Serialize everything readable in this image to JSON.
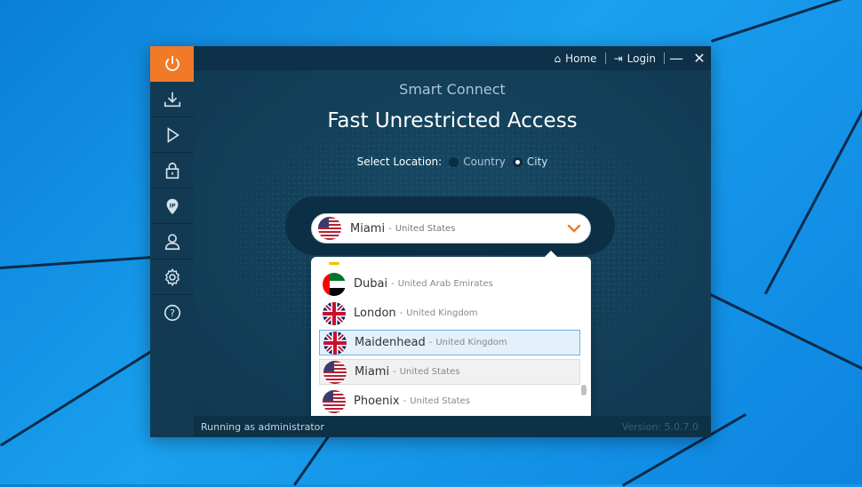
{
  "titlebar": {
    "home_label": "Home",
    "login_label": "Login",
    "minimize_icon": "minimize-icon",
    "close_icon": "close-icon"
  },
  "sidebar": {
    "items": [
      {
        "icon": "power-icon",
        "active": true
      },
      {
        "icon": "download-icon"
      },
      {
        "icon": "play-icon"
      },
      {
        "icon": "lock-icon"
      },
      {
        "icon": "ip-location-icon"
      },
      {
        "icon": "user-icon"
      },
      {
        "icon": "gear-icon"
      },
      {
        "icon": "help-icon"
      }
    ]
  },
  "main": {
    "mode_label": "Smart Connect",
    "headline": "Fast Unrestricted Access",
    "select_location_label": "Select Location:",
    "options": [
      {
        "label": "Country",
        "selected": false
      },
      {
        "label": "City",
        "selected": true
      }
    ],
    "selected_location": {
      "city": "Miami",
      "separator": "-",
      "country": "United States",
      "flag": "us"
    }
  },
  "dropdown": {
    "items": [
      {
        "city": "Dubai",
        "separator": "-",
        "country": "United Arab Emirates",
        "flag": "ae",
        "state": "normal"
      },
      {
        "city": "London",
        "separator": "-",
        "country": "United Kingdom",
        "flag": "gb",
        "state": "normal"
      },
      {
        "city": "Maidenhead",
        "separator": "-",
        "country": "United Kingdom",
        "flag": "gb",
        "state": "hover"
      },
      {
        "city": "Miami",
        "separator": "-",
        "country": "United States",
        "flag": "us",
        "state": "selected"
      },
      {
        "city": "Phoenix",
        "separator": "-",
        "country": "United States",
        "flag": "us",
        "state": "normal"
      }
    ]
  },
  "status": {
    "left": "Running as administrator",
    "right": "Version: 5.0.7.0"
  },
  "colors": {
    "accent": "#f07a28",
    "panel": "#0f3a52",
    "hover_border": "#6fb1e0"
  }
}
